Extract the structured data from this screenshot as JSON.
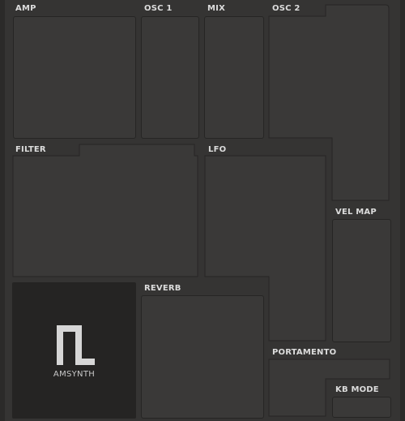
{
  "sections": {
    "amp": "AMP",
    "osc1": "OSC 1",
    "mix": "MIX",
    "osc2": "OSC 2",
    "filter": "FILTER",
    "lfo": "LFO",
    "vel_map": "VEL MAP",
    "reverb": "REVERB",
    "portamento": "PORTAMENTO",
    "kb_mode": "KB MODE"
  },
  "logo": {
    "text": "AMSYNTH",
    "icon": "amsynth-logo-icon"
  },
  "colors": {
    "background": "#2b2a29",
    "panel": "#353433",
    "section": "#3a3938",
    "border": "#262524",
    "label": "#dcdcdc",
    "logo_bg": "#252423"
  }
}
